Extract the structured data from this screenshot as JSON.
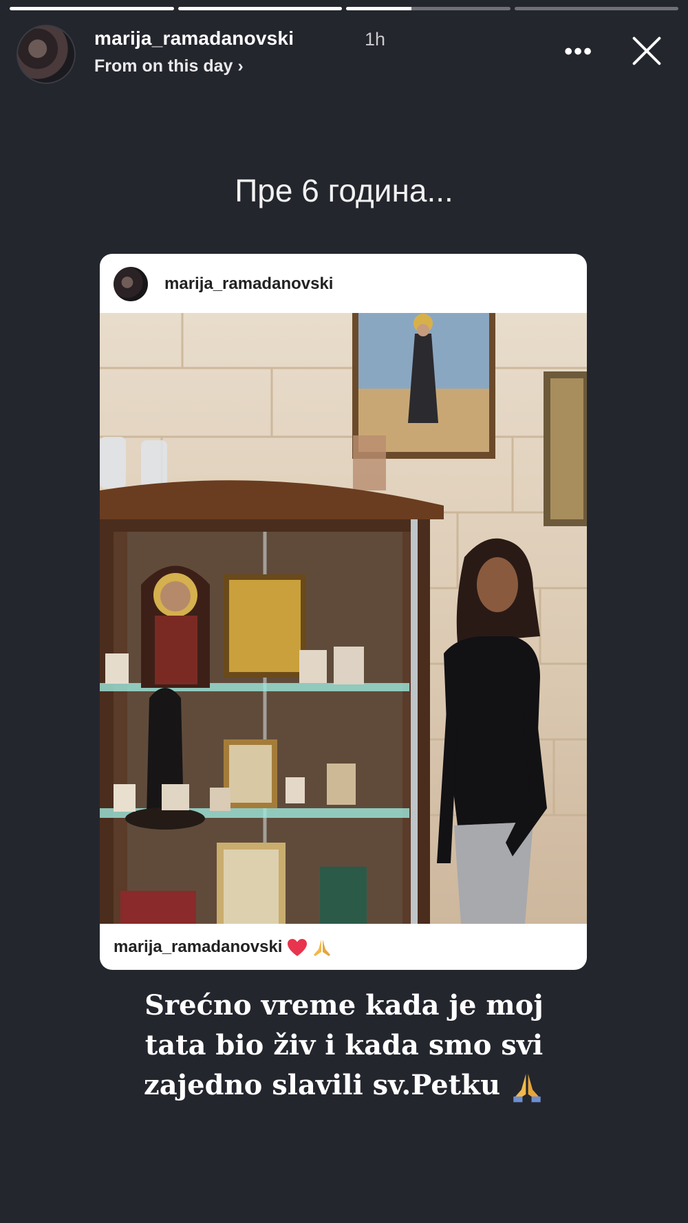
{
  "story": {
    "progress": [
      1.0,
      1.0,
      0.4,
      0.0
    ]
  },
  "header": {
    "username": "marija_ramadanovski",
    "time": "1h",
    "subtitle": "From on this day ›",
    "more_label": "•••"
  },
  "top_caption": "Пре 6 година...",
  "card": {
    "username": "marija_ramadanovski",
    "footer_username": "marija_ramadanovski"
  },
  "caption_lines": [
    "Srećno vreme kada je moj",
    "tata bio živ i kada smo svi",
    "zajedno slavili sv.Petku"
  ],
  "icons": {
    "heart": "heart-icon",
    "pray": "praying-hands-icon",
    "close": "close-icon",
    "more": "more-options-icon"
  }
}
